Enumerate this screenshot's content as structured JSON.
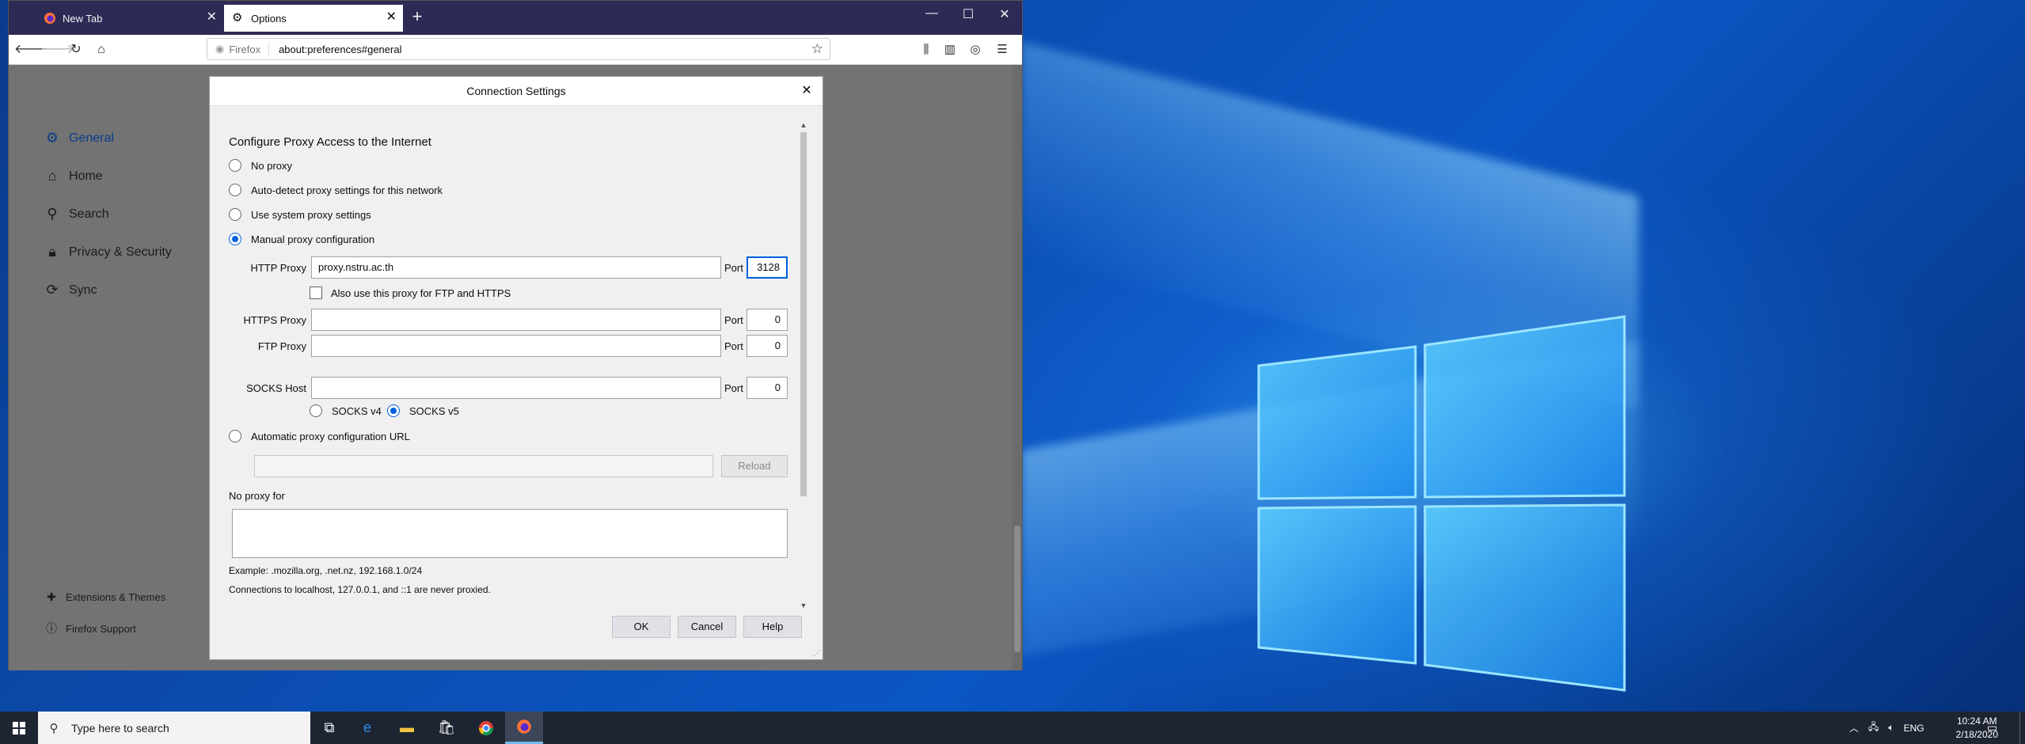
{
  "browser": {
    "tabs": [
      {
        "label": "New Tab",
        "active": false
      },
      {
        "label": "Options",
        "active": true
      }
    ],
    "new_tab_symbol": "+",
    "window_controls": {
      "minimize": "—",
      "maximize": "☐",
      "close": "✕"
    },
    "url_identity": "Firefox",
    "url": "about:preferences#general"
  },
  "sidebar": {
    "items": [
      {
        "label": "General",
        "icon": "gear-icon"
      },
      {
        "label": "Home",
        "icon": "home-icon"
      },
      {
        "label": "Search",
        "icon": "search-icon"
      },
      {
        "label": "Privacy & Security",
        "icon": "lock-icon"
      },
      {
        "label": "Sync",
        "icon": "sync-icon"
      }
    ],
    "footer": [
      {
        "label": "Extensions & Themes",
        "icon": "puzzle-icon"
      },
      {
        "label": "Firefox Support",
        "icon": "help-icon"
      }
    ]
  },
  "dialog": {
    "title": "Connection Settings",
    "heading": "Configure Proxy Access to the Internet",
    "options": {
      "no_proxy": "No proxy",
      "auto_detect": "Auto-detect proxy settings for this network",
      "system": "Use system proxy settings",
      "manual": "Manual proxy configuration",
      "auto_url": "Automatic proxy configuration URL"
    },
    "selected_option": "manual",
    "http_proxy_label": "HTTP Proxy",
    "http_proxy_value": "proxy.nstru.ac.th",
    "port_label": "Port",
    "http_port": "3128",
    "also_use_label": "Also use this proxy for FTP and HTTPS",
    "https_proxy_label": "HTTPS Proxy",
    "https_port": "0",
    "ftp_proxy_label": "FTP Proxy",
    "ftp_port": "0",
    "socks_host_label": "SOCKS Host",
    "socks_port": "0",
    "socks_v4": "SOCKS v4",
    "socks_v5": "SOCKS v5",
    "reload_label": "Reload",
    "no_proxy_for_label": "No proxy for",
    "example_text": "Example: .mozilla.org, .net.nz, 192.168.1.0/24",
    "localhost_text": "Connections to localhost, 127.0.0.1, and ::1 are never proxied.",
    "ok_label": "OK",
    "cancel_label": "Cancel",
    "help_label": "Help"
  },
  "taskbar": {
    "search_placeholder": "Type here to search",
    "language": "ENG",
    "time": "10:24 AM",
    "date": "2/18/2020"
  }
}
